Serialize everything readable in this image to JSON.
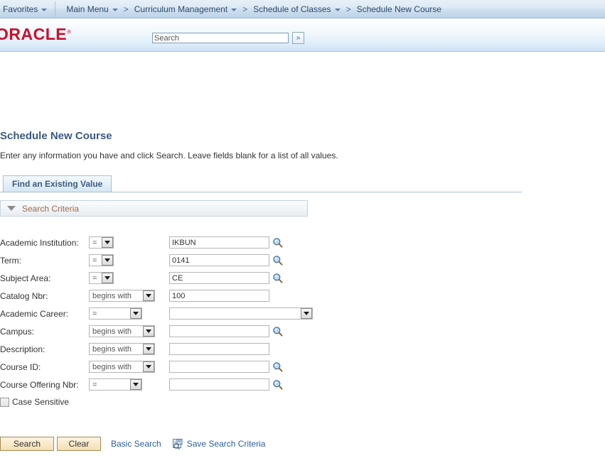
{
  "navbar": {
    "favorites": "Favorites",
    "main_menu": "Main Menu",
    "breadcrumbs": [
      "Curriculum Management",
      "Schedule of Classes"
    ],
    "current": "Schedule New Course",
    "separator": ">"
  },
  "header": {
    "logo": "ORACLE",
    "trademark": "®",
    "search_placeholder": "Search",
    "search_value": "",
    "search_go_label": "»"
  },
  "page": {
    "title": "Schedule New Course",
    "instruction": "Enter any information you have and click Search. Leave fields blank for a list of all values."
  },
  "tabs": [
    {
      "label": "Find an Existing Value",
      "active": true
    }
  ],
  "criteria_section": {
    "title": "Search Criteria",
    "expanded": true
  },
  "fields": [
    {
      "label": "Academic Institution:",
      "operator": "=",
      "operator_width": "eq",
      "value": "IKBUN",
      "control": "text",
      "has_lookup": true
    },
    {
      "label": "Term:",
      "operator": "=",
      "operator_width": "eq",
      "value": "0141",
      "control": "text",
      "has_lookup": true
    },
    {
      "label": "Subject Area:",
      "operator": "=",
      "operator_width": "eq",
      "value": "CE",
      "control": "text",
      "has_lookup": true
    },
    {
      "label": "Catalog Nbr:",
      "operator": "begins with",
      "operator_width": "begins",
      "value": "100",
      "control": "text",
      "has_lookup": false
    },
    {
      "label": "Academic Career:",
      "operator": "=",
      "operator_width": "eq-wide",
      "value": "",
      "control": "select",
      "has_lookup": false
    },
    {
      "label": "Campus:",
      "operator": "begins with",
      "operator_width": "begins",
      "value": "",
      "control": "text",
      "has_lookup": true
    },
    {
      "label": "Description:",
      "operator": "begins with",
      "operator_width": "begins",
      "value": "",
      "control": "text",
      "has_lookup": false
    },
    {
      "label": "Course ID:",
      "operator": "begins with",
      "operator_width": "begins",
      "value": "",
      "control": "text",
      "has_lookup": true
    },
    {
      "label": "Course Offering Nbr:",
      "operator": "=",
      "operator_width": "eq-wide",
      "value": "",
      "control": "text",
      "has_lookup": true
    }
  ],
  "case_sensitive": {
    "label": "Case Sensitive",
    "checked": false
  },
  "actions": {
    "search": "Search",
    "clear": "Clear",
    "basic_search": "Basic Search",
    "save_search_criteria": "Save Search Criteria"
  },
  "colors": {
    "title_blue": "#3b5a80",
    "link_blue": "#2b5f9e",
    "criteria_brown": "#9e6b4a",
    "oracle_red": "#c8102e",
    "button_tan": "#f5e3bb"
  }
}
